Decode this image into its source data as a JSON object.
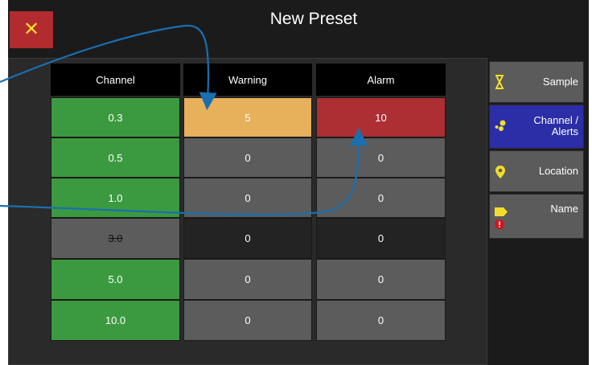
{
  "window": {
    "title": "New Preset"
  },
  "close_button": {
    "glyph": "✕"
  },
  "table": {
    "headers": {
      "channel": "Channel",
      "warning": "Warning",
      "alarm": "Alarm"
    },
    "rows": [
      {
        "channel": "0.3",
        "warning": "5",
        "alarm": "10"
      },
      {
        "channel": "0.5",
        "warning": "0",
        "alarm": "0"
      },
      {
        "channel": "1.0",
        "warning": "0",
        "alarm": "0"
      },
      {
        "channel": "3.0",
        "warning": "0",
        "alarm": "0"
      },
      {
        "channel": "5.0",
        "warning": "0",
        "alarm": "0"
      },
      {
        "channel": "10.0",
        "warning": "0",
        "alarm": "0"
      }
    ]
  },
  "sidebar": {
    "items": [
      {
        "label": "Sample",
        "icon": "hourglass-icon"
      },
      {
        "label": "Channel /\nAlerts",
        "icon": "dots-icon"
      },
      {
        "label": "Location",
        "icon": "location-pin-icon"
      },
      {
        "label": "Name",
        "icon": "tag-icon"
      }
    ]
  },
  "colors": {
    "background": "#1b1b1b",
    "green": "#3b9a3f",
    "warning_orange": "#e7b05a",
    "alarm_red": "#ad2e33",
    "active_blue": "#2b2ea7",
    "annotation_arrow": "#1a6fb0",
    "icon_yellow": "#f2dd2a",
    "error_red": "#d0161e"
  }
}
